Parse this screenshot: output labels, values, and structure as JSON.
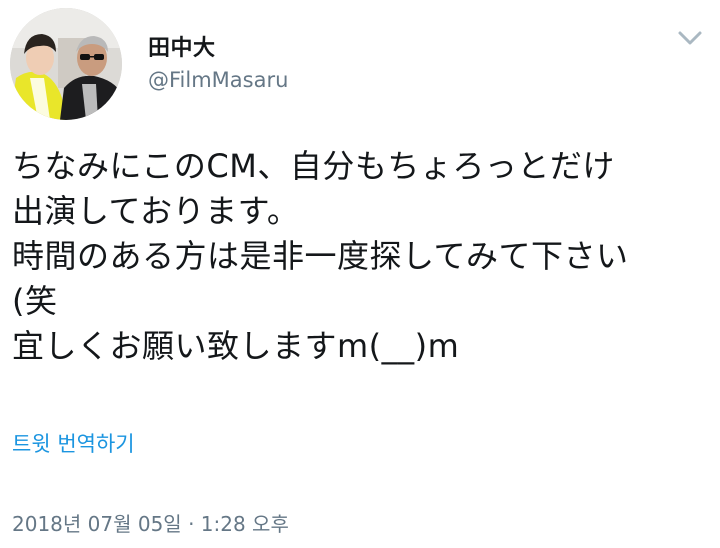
{
  "user": {
    "display_name": "田中大",
    "handle": "@FilmMasaru"
  },
  "tweet": {
    "lines": [
      "ちなみにこのCM、自分もちょろっとだけ",
      "出演しております。",
      "時間のある方は是非一度探してみて下さい",
      "(笑",
      "宜しくお願い致しますm(__)m"
    ],
    "translate_label": "트윗 번역하기",
    "timestamp": "2018년 07월 05일 · 1:28 오후"
  },
  "icons": {
    "menu": "chevron-down-icon",
    "avatar": "profile-photo"
  },
  "colors": {
    "text": "#14171a",
    "secondary": "#657786",
    "link": "#1b95e0"
  }
}
